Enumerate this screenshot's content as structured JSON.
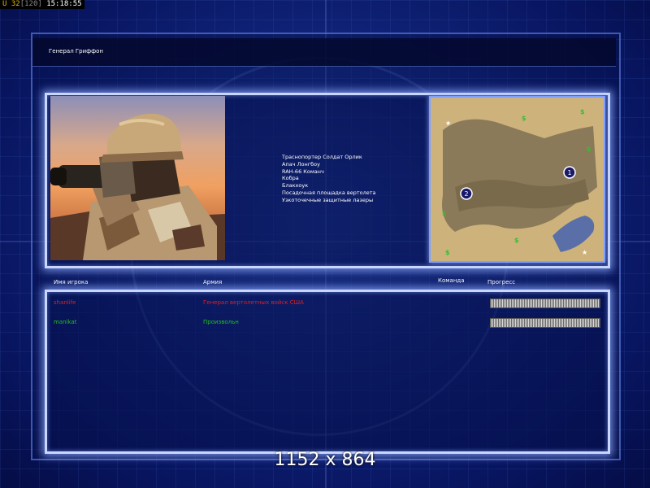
{
  "status_bar": {
    "unit_label": "U 32",
    "fps": "[120]",
    "time": "15:18:55"
  },
  "header": {
    "title": "Генерал Гриффон"
  },
  "briefing": {
    "items": [
      "Траснопортер Солдат Орлик",
      "Апач Лонгбоу",
      "RAH-66 Команч",
      "Кобра",
      "Блакхоук",
      "Посадочная площадка вертолета",
      "Узкоточечные защитные лазеры"
    ]
  },
  "minimap": {
    "start_positions": [
      "1",
      "2"
    ],
    "icons": [
      "star-icon",
      "supply-dollar-icon"
    ]
  },
  "players_table": {
    "columns": {
      "name": "Имя игрока",
      "army": "Армия",
      "team": "Команда",
      "progress": "Прогресс"
    },
    "rows": [
      {
        "name": "shanlife",
        "army": "Генерал вертолетных войск США",
        "team": "",
        "progress": 1.0,
        "color": "#e02020"
      },
      {
        "name": "manikat",
        "army": "Произвольн",
        "team": "",
        "progress": 1.0,
        "color": "#20c020"
      }
    ]
  },
  "overlay": {
    "resolution_label": "1152 x 864"
  },
  "colors": {
    "panel_border": "#c9d6ff",
    "background": "#10247a",
    "player1": "#e02020",
    "player2": "#20c020"
  }
}
